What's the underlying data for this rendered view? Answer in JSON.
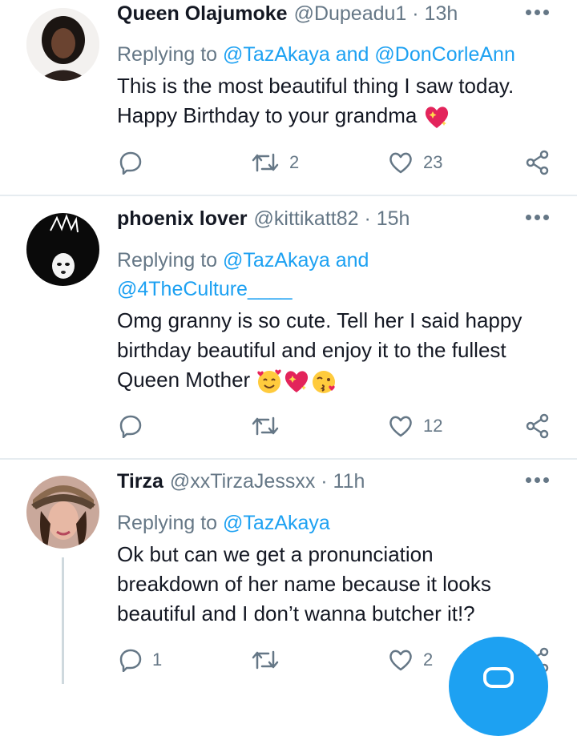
{
  "tweets": [
    {
      "name": "Queen Olajumoke",
      "meta": "@Dupeadu1 · 13h",
      "replying_prefix": "Replying to",
      "replying_lines": [
        "@TazAkaya and @DonCorleAnn"
      ],
      "body_lines": [
        "This is the most beautiful thing I saw today.",
        "Happy Birthday to your grandma"
      ],
      "emojis": [
        "sparkling-heart"
      ],
      "replies": "",
      "retweets": "2",
      "likes": "23"
    },
    {
      "name": "phoenix lover",
      "meta": "@kittikatt82 · 15h",
      "replying_prefix": "Replying to",
      "replying_lines": [
        "@TazAkaya and",
        "@4TheCulture____"
      ],
      "body_lines": [
        "Omg granny is so cute. Tell her I said happy",
        "birthday beautiful and enjoy it to the fullest",
        "Queen Mother"
      ],
      "emojis": [
        "smiling-face-with-hearts",
        "sparkling-heart",
        "face-blowing-kiss"
      ],
      "replies": "",
      "retweets": "",
      "likes": "12"
    },
    {
      "name": "Tirza",
      "meta": "@xxTirzaJessxx · 11h",
      "replying_prefix": "Replying to",
      "replying_lines": [
        "@TazAkaya"
      ],
      "body_lines": [
        "Ok but can we get a pronunciation",
        "breakdown of her name because it looks",
        "beautiful and I don’t wanna butcher it!?"
      ],
      "emojis": [],
      "replies": "1",
      "retweets": "",
      "likes": "2"
    }
  ],
  "colors": {
    "accent": "#1da1f2",
    "muted": "#657786",
    "text": "#141823",
    "divider": "#e6ecf0"
  }
}
